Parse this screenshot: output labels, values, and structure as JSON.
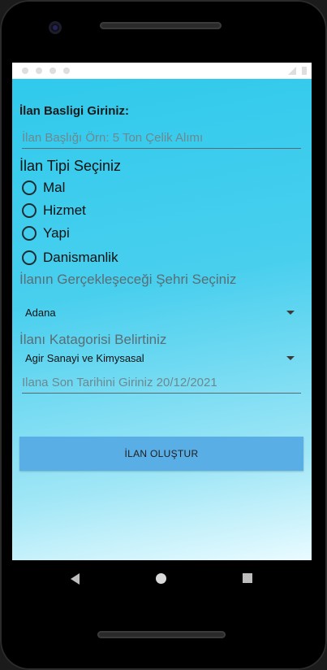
{
  "form": {
    "title_label": "İlan Basligi Giriniz:",
    "title_placeholder": "İlan Başlığı Örn: 5 Ton Çelik Alımı",
    "type_label": "İlan Tipi Seçiniz",
    "type_options": [
      {
        "label": "Mal",
        "selected": false
      },
      {
        "label": "Hizmet",
        "selected": false
      },
      {
        "label": "Yapi",
        "selected": false
      },
      {
        "label": "Danismanlik",
        "selected": false
      }
    ],
    "city_label": "İlanın Gerçekleşeceği Şehri Seçiniz",
    "city_value": "Adana",
    "category_label": "İlanı Katagorisi Belirtiniz",
    "category_value": "Agir Sanayi ve Kimysasal",
    "date_placeholder": "Ilana Son Tarihini Giriniz 20/12/2021",
    "create_button_label": "İLAN OLUŞTUR"
  },
  "icons": {
    "nav_back": "back-icon",
    "nav_home": "home-icon",
    "nav_recent": "recent-apps-icon",
    "dropdown": "dropdown-caret-icon"
  },
  "colors": {
    "gradient_top": "#2ec9ec",
    "gradient_bottom": "#e9fbff",
    "button": "#5aaee6"
  }
}
